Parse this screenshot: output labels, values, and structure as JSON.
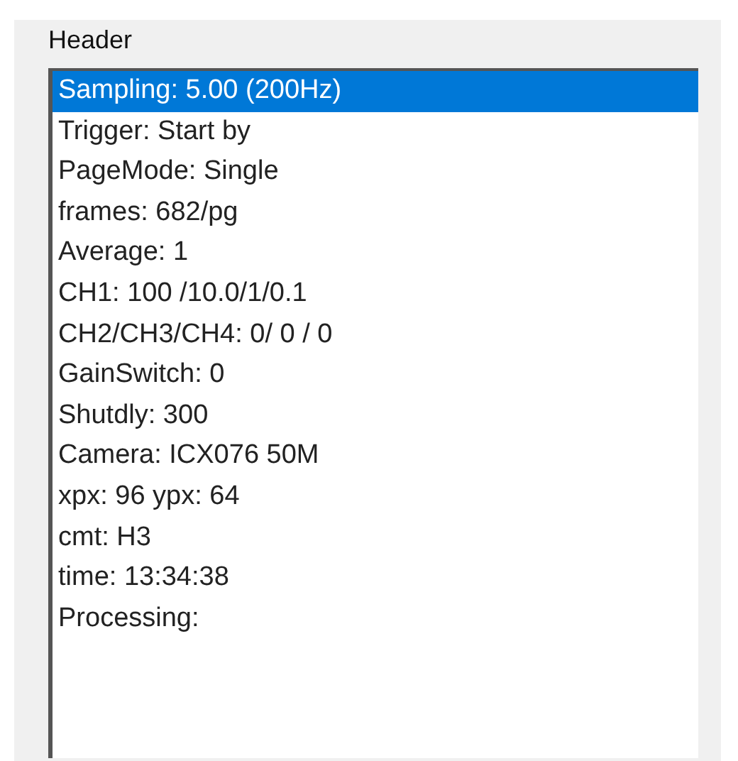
{
  "group": {
    "label": "Header"
  },
  "list": {
    "items": [
      {
        "text": "Sampling: 5.00 (200Hz)",
        "selected": true
      },
      {
        "text": "Trigger: Start by",
        "selected": false
      },
      {
        "text": "PageMode: Single",
        "selected": false
      },
      {
        "text": "frames: 682/pg",
        "selected": false
      },
      {
        "text": "Average: 1",
        "selected": false
      },
      {
        "text": "CH1: 100 /10.0/1/0.1",
        "selected": false
      },
      {
        "text": "CH2/CH3/CH4: 0/ 0 / 0",
        "selected": false
      },
      {
        "text": "GainSwitch: 0",
        "selected": false
      },
      {
        "text": "Shutdly: 300",
        "selected": false
      },
      {
        "text": "Camera: ICX076 50M",
        "selected": false
      },
      {
        "text": "xpx: 96 ypx: 64",
        "selected": false
      },
      {
        "text": "cmt: H3",
        "selected": false
      },
      {
        "text": "time: 13:34:38",
        "selected": false
      },
      {
        "text": "Processing:",
        "selected": false
      }
    ]
  }
}
